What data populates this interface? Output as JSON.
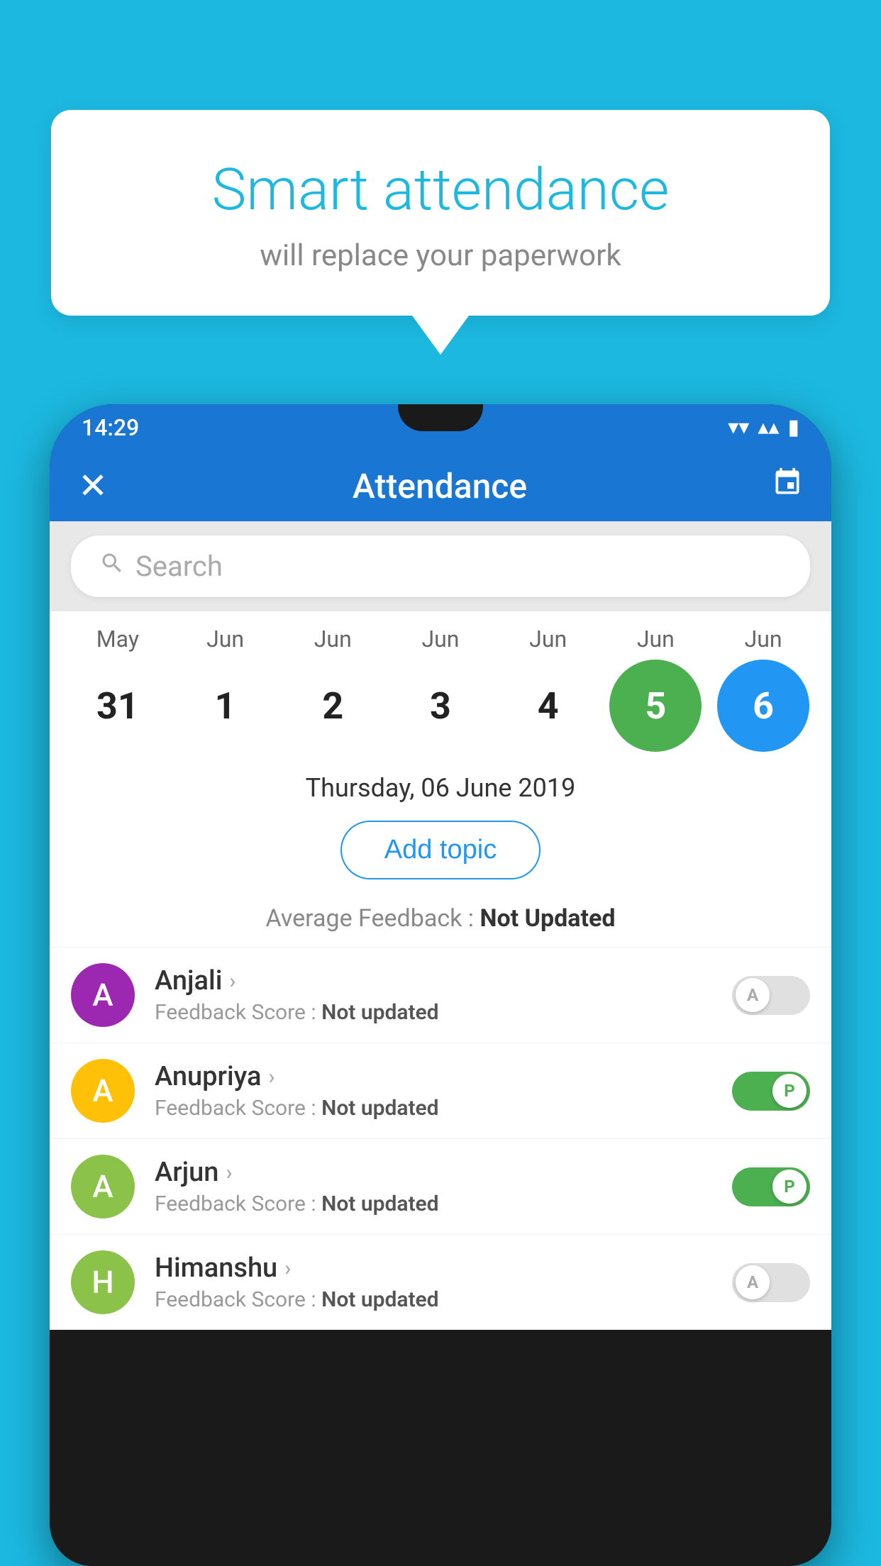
{
  "background_color": "#1cb8e0",
  "bubble": {
    "title": "Smart attendance",
    "subtitle": "will replace your paperwork"
  },
  "status_bar": {
    "time": "14:29",
    "wifi": "▼",
    "signal": "▲",
    "battery": "▮"
  },
  "app_bar": {
    "close_label": "✕",
    "title": "Attendance",
    "calendar_icon": "📅"
  },
  "search": {
    "placeholder": "Search"
  },
  "calendar": {
    "months": [
      "May",
      "Jun",
      "Jun",
      "Jun",
      "Jun",
      "Jun",
      "Jun"
    ],
    "days": [
      "31",
      "1",
      "2",
      "3",
      "4",
      "5",
      "6"
    ],
    "today_index": 5,
    "selected_index": 6
  },
  "date_label": "Thursday, 06 June 2019",
  "add_topic_label": "Add topic",
  "avg_feedback_label": "Average Feedback :",
  "avg_feedback_value": "Not Updated",
  "students": [
    {
      "name": "Anjali",
      "initial": "A",
      "avatar_color": "#9c27b0",
      "feedback_label": "Feedback Score :",
      "feedback_value": "Not updated",
      "status": "absent"
    },
    {
      "name": "Anupriya",
      "initial": "A",
      "avatar_color": "#ffc107",
      "feedback_label": "Feedback Score :",
      "feedback_value": "Not updated",
      "status": "present"
    },
    {
      "name": "Arjun",
      "initial": "A",
      "avatar_color": "#8bc34a",
      "feedback_label": "Feedback Score :",
      "feedback_value": "Not updated",
      "status": "present"
    },
    {
      "name": "Himanshu",
      "initial": "H",
      "avatar_color": "#8bc34a",
      "feedback_label": "Feedback Score :",
      "feedback_value": "Not updated",
      "status": "absent"
    }
  ]
}
